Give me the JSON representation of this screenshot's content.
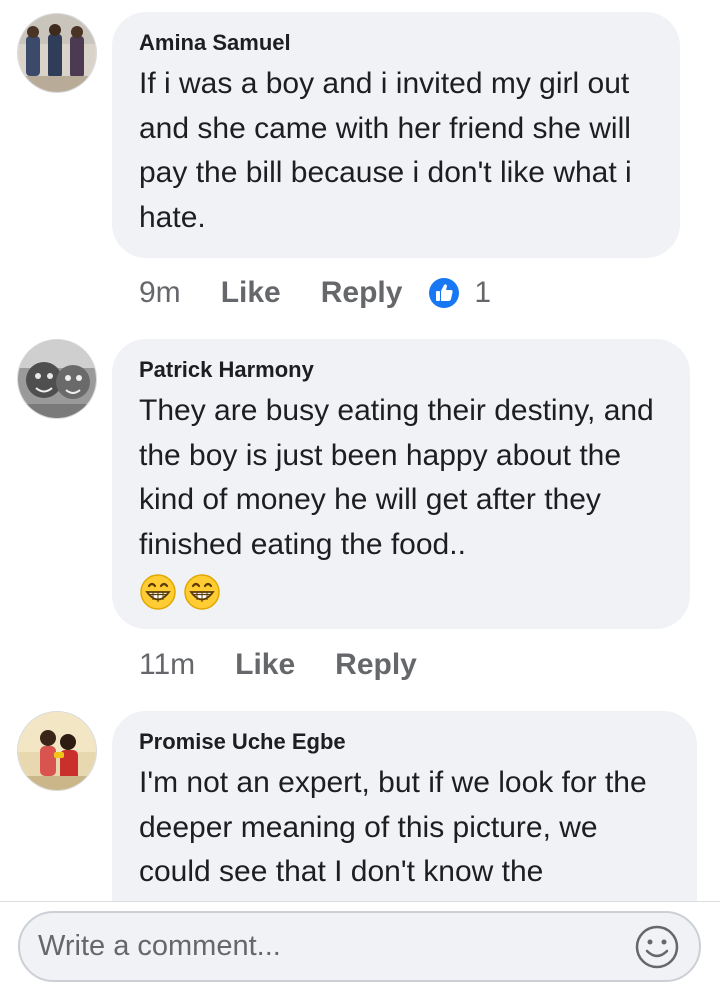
{
  "comments": [
    {
      "author": "Amina Samuel",
      "text": "If i was a boy and i invited my girl out and she came with her friend she will pay the bill because i don't like what i hate.",
      "time": "9m",
      "like_label": "Like",
      "reply_label": "Reply",
      "reaction_icon": "like-reaction-icon",
      "reaction_count": "1"
    },
    {
      "author": "Patrick Harmony",
      "text": "They are busy eating their destiny, and the boy is just been happy about the kind of money he will get after they finished eating the food..",
      "emojis": [
        "grinning-face-emoji",
        "grinning-face-emoji"
      ],
      "time": "11m",
      "like_label": "Like",
      "reply_label": "Reply"
    },
    {
      "author": "Promise Uche Egbe",
      "text": "I'm not an expert, but if we look for the deeper meaning of this picture, we could see that I don't know the"
    }
  ],
  "composer": {
    "placeholder": "Write a comment...",
    "emoji_icon": "smiley-icon"
  },
  "colors": {
    "bubble": "#f0f2f5",
    "secondary_text": "#65676b",
    "like_blue": "#1877f2"
  }
}
